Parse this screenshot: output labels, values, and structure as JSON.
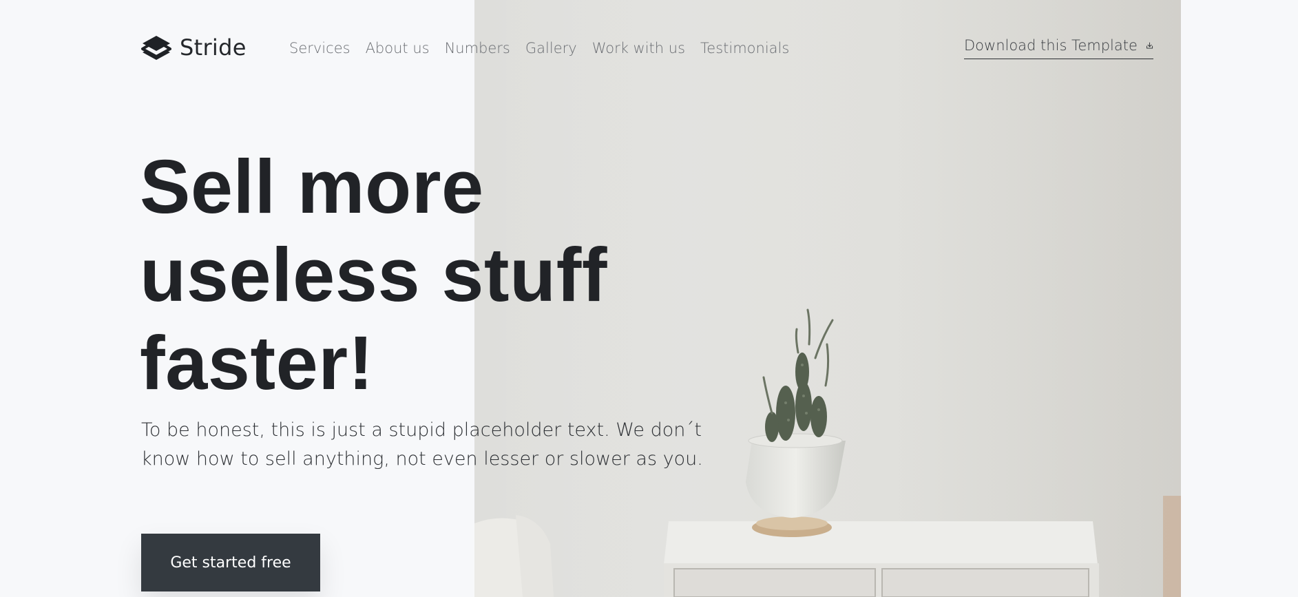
{
  "brand": {
    "name": "Stride",
    "logo_icon": "layers-icon"
  },
  "nav": {
    "items": [
      {
        "label": "Services"
      },
      {
        "label": "About us"
      },
      {
        "label": "Numbers"
      },
      {
        "label": "Gallery"
      },
      {
        "label": "Work with us"
      },
      {
        "label": "Testimonials"
      }
    ]
  },
  "download": {
    "label": "Download this Template",
    "icon": "download-icon"
  },
  "hero": {
    "title": "Sell more useless stuff faster!",
    "subtitle": "To be honest, this is just a stupid placeholder text. We don´t know how to sell anything, not even lesser or slower as you.",
    "cta_label": "Get started free",
    "image": "cactus-on-white-cabinet-photo"
  },
  "colors": {
    "background": "#f7f8fa",
    "text_dark": "#212327",
    "nav_text": "#6b6e73",
    "button_bg": "#343a40",
    "button_text": "#ffffff"
  }
}
